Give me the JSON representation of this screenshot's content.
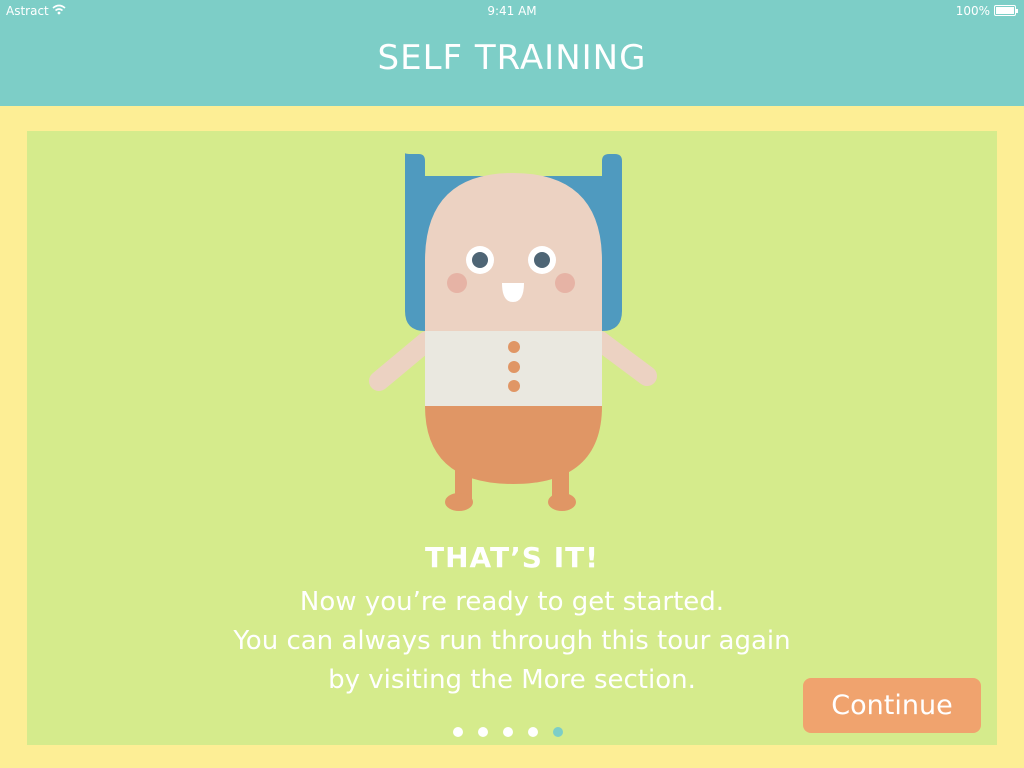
{
  "status_bar": {
    "carrier": "Astract",
    "wifi_icon": "wifi-icon",
    "time": "9:41 AM",
    "battery": "100%",
    "battery_icon": "battery-icon"
  },
  "header": {
    "title": "SELF TRAINING",
    "background": "#7dcec7"
  },
  "card": {
    "background": "#d5eb8c",
    "heading": "THAT’S IT!",
    "body_lines": [
      "Now you’re ready to get started.",
      "You can always run through this tour again",
      "by visiting the More section."
    ],
    "illustration": "character-illustration"
  },
  "pagination": {
    "total": 5,
    "current": 5,
    "active_color": "#7dcec7"
  },
  "continue_button": {
    "label": "Continue",
    "background": "#f0a36e"
  },
  "page_background": "#fdee95"
}
